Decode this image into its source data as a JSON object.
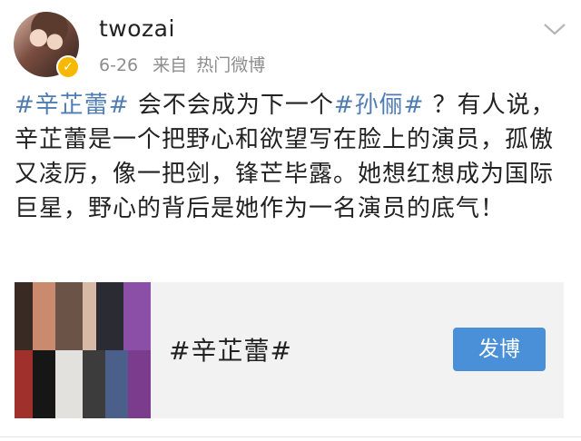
{
  "post": {
    "username": "twozai",
    "date": "6-26",
    "source_prefix": "来自",
    "source": "热门微博",
    "content_parts": [
      {
        "text": "#辛芷蕾#",
        "topic": true
      },
      {
        "text": " 会不会成为下一个",
        "topic": false
      },
      {
        "text": "#孙俪#",
        "topic": true
      },
      {
        "text": " ？有人说，辛芷蕾是一个把野心和欲望写在脸上的演员，孤傲又凌厉，像一把剑，锋芒毕露。她想红想成为国际巨星，野心的背后是她作为一名演员的底气！",
        "topic": false
      }
    ]
  },
  "card": {
    "title": "#辛芷蕾#",
    "button_label": "发博"
  },
  "colors": {
    "topic": "#4f7cb2",
    "button": "#4a90d9",
    "verified": "#f7b900"
  }
}
